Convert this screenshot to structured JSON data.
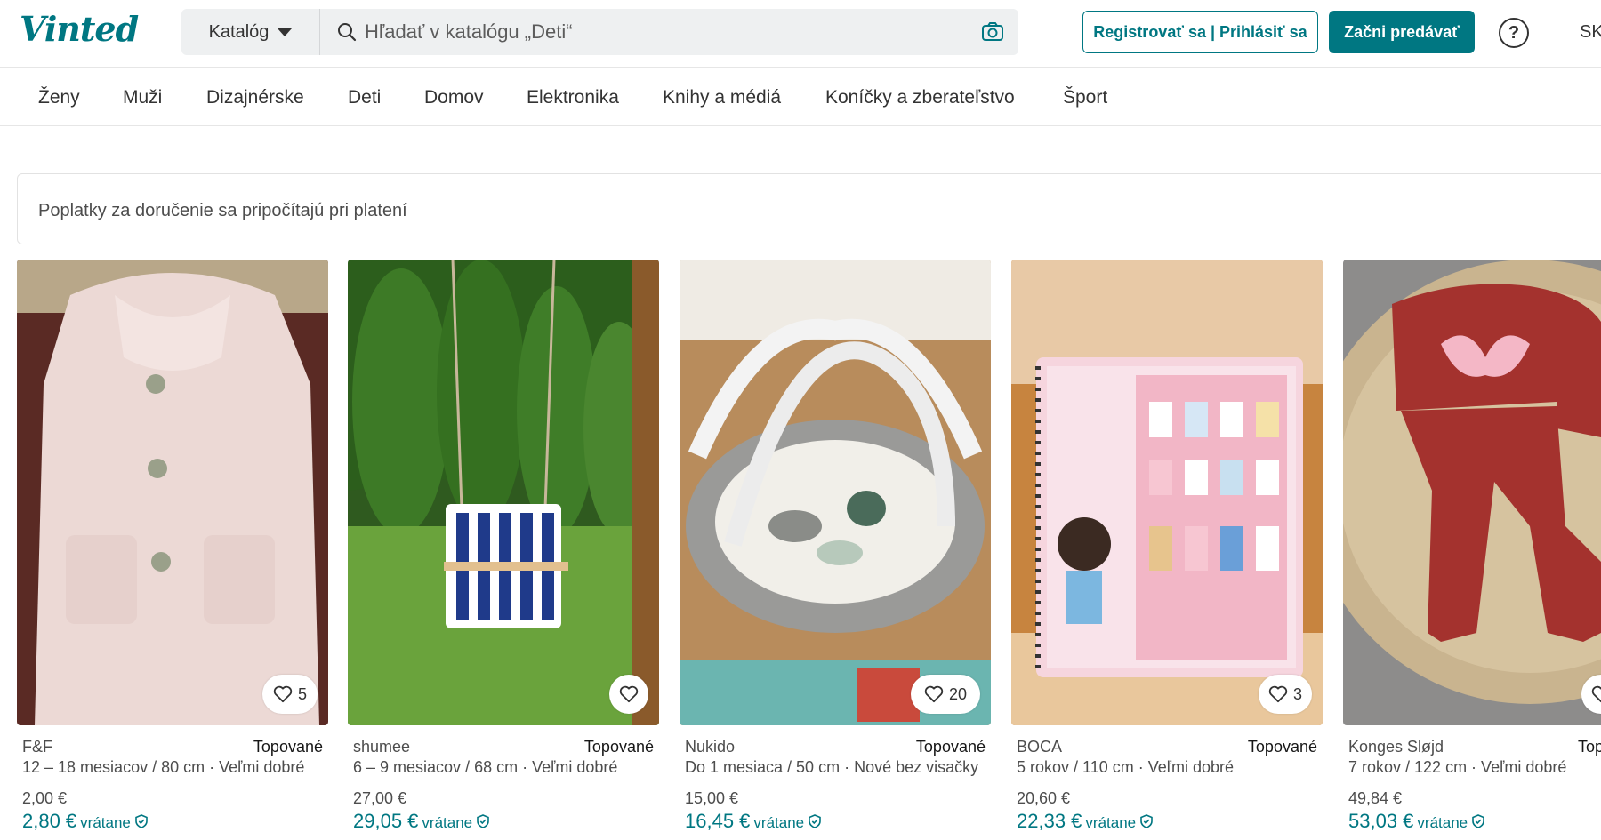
{
  "header": {
    "logo": "Vinted",
    "catalog_label": "Katalóg",
    "search_placeholder": "Hľadať v katalógu „Deti“",
    "register_label": "Registrovať sa | Prihlásiť sa",
    "sell_label": "Začni predávať",
    "help_glyph": "?",
    "language": "SK"
  },
  "categories": [
    "Ženy",
    "Muži",
    "Dizajnérske",
    "Deti",
    "Domov",
    "Elektronika",
    "Knihy a médiá",
    "Koníčky a zberateľstvo",
    "Šport"
  ],
  "notice": "Poplatky za doručenie sa pripočítajú pri platení",
  "items": [
    {
      "brand": "F&F",
      "badge": "Topované",
      "size": "12 – 18 mesiacov / 80 cm · Veľmi dobré",
      "price": "2,00 €",
      "total": "2,80 €",
      "incl": "vrátane",
      "favorites": "5"
    },
    {
      "brand": "shumee",
      "badge": "Topované",
      "size": "6 – 9 mesiacov / 68 cm · Veľmi dobré",
      "price": "27,00 €",
      "total": "29,05 €",
      "incl": "vrátane",
      "favorites": ""
    },
    {
      "brand": "Nukido",
      "badge": "Topované",
      "size": "Do 1 mesiaca / 50 cm · Nové bez visačky",
      "price": "15,00 €",
      "total": "16,45 €",
      "incl": "vrátane",
      "favorites": "20"
    },
    {
      "brand": "BOCA",
      "badge": "Topované",
      "size": "5 rokov / 110 cm · Veľmi dobré",
      "price": "20,60 €",
      "total": "22,33 €",
      "incl": "vrátane",
      "favorites": "3"
    },
    {
      "brand": "Konges Sløjd",
      "badge": "Topované",
      "size": "7 rokov / 122 cm · Veľmi dobré",
      "price": "49,84 €",
      "total": "53,03 €",
      "incl": "vrátane",
      "favorites": ""
    }
  ],
  "colors": {
    "accent": "#007782",
    "search_bg": "#eef0f1"
  },
  "icons": [
    "search-icon",
    "camera-icon",
    "help-icon",
    "heart-icon",
    "shield-icon",
    "chevron-down-icon"
  ]
}
